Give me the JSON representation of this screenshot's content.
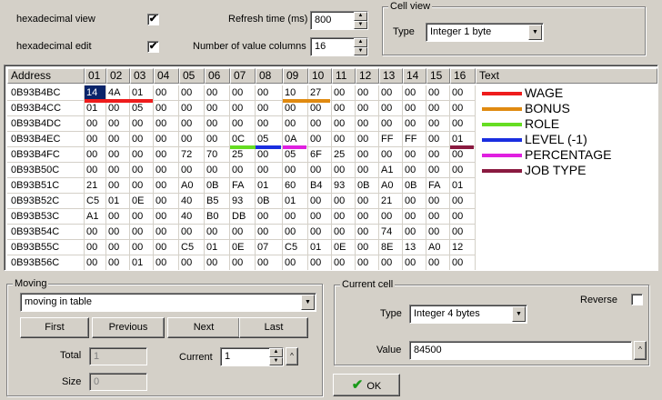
{
  "top": {
    "hex_view_label": "hexadecimal view",
    "hex_view_checked": "✔",
    "hex_edit_label": "hexadecimal edit",
    "hex_edit_checked": "✔",
    "refresh_label": "Refresh time (ms)",
    "refresh_value": "800",
    "columns_label": "Number of value columns",
    "columns_value": "16"
  },
  "cell_view": {
    "title": "Cell view",
    "type_label": "Type",
    "type_value": "Integer 1 byte"
  },
  "grid": {
    "headers": [
      "Address",
      "01",
      "02",
      "03",
      "04",
      "05",
      "06",
      "07",
      "08",
      "09",
      "10",
      "11",
      "12",
      "13",
      "14",
      "15",
      "16",
      "Text"
    ],
    "rows": [
      {
        "addr": "0B93B4BC",
        "cells": [
          "14",
          "4A",
          "01",
          "00",
          "00",
          "00",
          "00",
          "00",
          "10",
          "27",
          "00",
          "00",
          "00",
          "00",
          "00",
          "00"
        ]
      },
      {
        "addr": "0B93B4CC",
        "cells": [
          "01",
          "00",
          "05",
          "00",
          "00",
          "00",
          "00",
          "00",
          "00",
          "00",
          "00",
          "00",
          "00",
          "00",
          "00",
          "00"
        ]
      },
      {
        "addr": "0B93B4DC",
        "cells": [
          "00",
          "00",
          "00",
          "00",
          "00",
          "00",
          "00",
          "00",
          "00",
          "00",
          "00",
          "00",
          "00",
          "00",
          "00",
          "00"
        ]
      },
      {
        "addr": "0B93B4EC",
        "cells": [
          "00",
          "00",
          "00",
          "00",
          "00",
          "00",
          "0C",
          "05",
          "0A",
          "00",
          "00",
          "00",
          "FF",
          "FF",
          "00",
          "01"
        ]
      },
      {
        "addr": "0B93B4FC",
        "cells": [
          "00",
          "00",
          "00",
          "00",
          "72",
          "70",
          "25",
          "00",
          "05",
          "6F",
          "25",
          "00",
          "00",
          "00",
          "00",
          "00"
        ]
      },
      {
        "addr": "0B93B50C",
        "cells": [
          "00",
          "00",
          "00",
          "00",
          "00",
          "00",
          "00",
          "00",
          "00",
          "00",
          "00",
          "00",
          "A1",
          "00",
          "00",
          "00"
        ]
      },
      {
        "addr": "0B93B51C",
        "cells": [
          "21",
          "00",
          "00",
          "00",
          "A0",
          "0B",
          "FA",
          "01",
          "60",
          "B4",
          "93",
          "0B",
          "A0",
          "0B",
          "FA",
          "01"
        ]
      },
      {
        "addr": "0B93B52C",
        "cells": [
          "C5",
          "01",
          "0E",
          "00",
          "40",
          "B5",
          "93",
          "0B",
          "01",
          "00",
          "00",
          "00",
          "21",
          "00",
          "00",
          "00"
        ]
      },
      {
        "addr": "0B93B53C",
        "cells": [
          "A1",
          "00",
          "00",
          "00",
          "40",
          "B0",
          "DB",
          "00",
          "00",
          "00",
          "00",
          "00",
          "00",
          "00",
          "00",
          "00"
        ]
      },
      {
        "addr": "0B93B54C",
        "cells": [
          "00",
          "00",
          "00",
          "00",
          "00",
          "00",
          "00",
          "00",
          "00",
          "00",
          "00",
          "00",
          "74",
          "00",
          "00",
          "00"
        ]
      },
      {
        "addr": "0B93B55C",
        "cells": [
          "00",
          "00",
          "00",
          "00",
          "C5",
          "01",
          "0E",
          "07",
          "C5",
          "01",
          "0E",
          "00",
          "8E",
          "13",
          "A0",
          "12"
        ]
      },
      {
        "addr": "0B93B56C",
        "cells": [
          "00",
          "00",
          "01",
          "00",
          "00",
          "00",
          "00",
          "00",
          "00",
          "00",
          "00",
          "00",
          "00",
          "00",
          "00",
          "00"
        ]
      }
    ],
    "legend": [
      {
        "label": "WAGE",
        "color": "#ee1c1c"
      },
      {
        "label": "BONUS",
        "color": "#e08a10"
      },
      {
        "label": "ROLE",
        "color": "#66dd22"
      },
      {
        "label": "LEVEL (-1)",
        "color": "#1a2ee0"
      },
      {
        "label": "PERCENTAGE",
        "color": "#e020e0"
      },
      {
        "label": "JOB TYPE",
        "color": "#8a1a40"
      }
    ]
  },
  "moving": {
    "title": "Moving",
    "mode_value": "moving in table",
    "first_label": "First",
    "previous_label": "Previous",
    "next_label": "Next",
    "last_label": "Last",
    "total_label": "Total",
    "total_value": "1",
    "current_label": "Current",
    "current_value": "1",
    "size_label": "Size",
    "size_value": "0"
  },
  "current_cell": {
    "title": "Current cell",
    "reverse_label": "Reverse",
    "type_label": "Type",
    "type_value": "Integer 4 bytes",
    "value_label": "Value",
    "value_value": "84500",
    "ok_label": "OK"
  }
}
